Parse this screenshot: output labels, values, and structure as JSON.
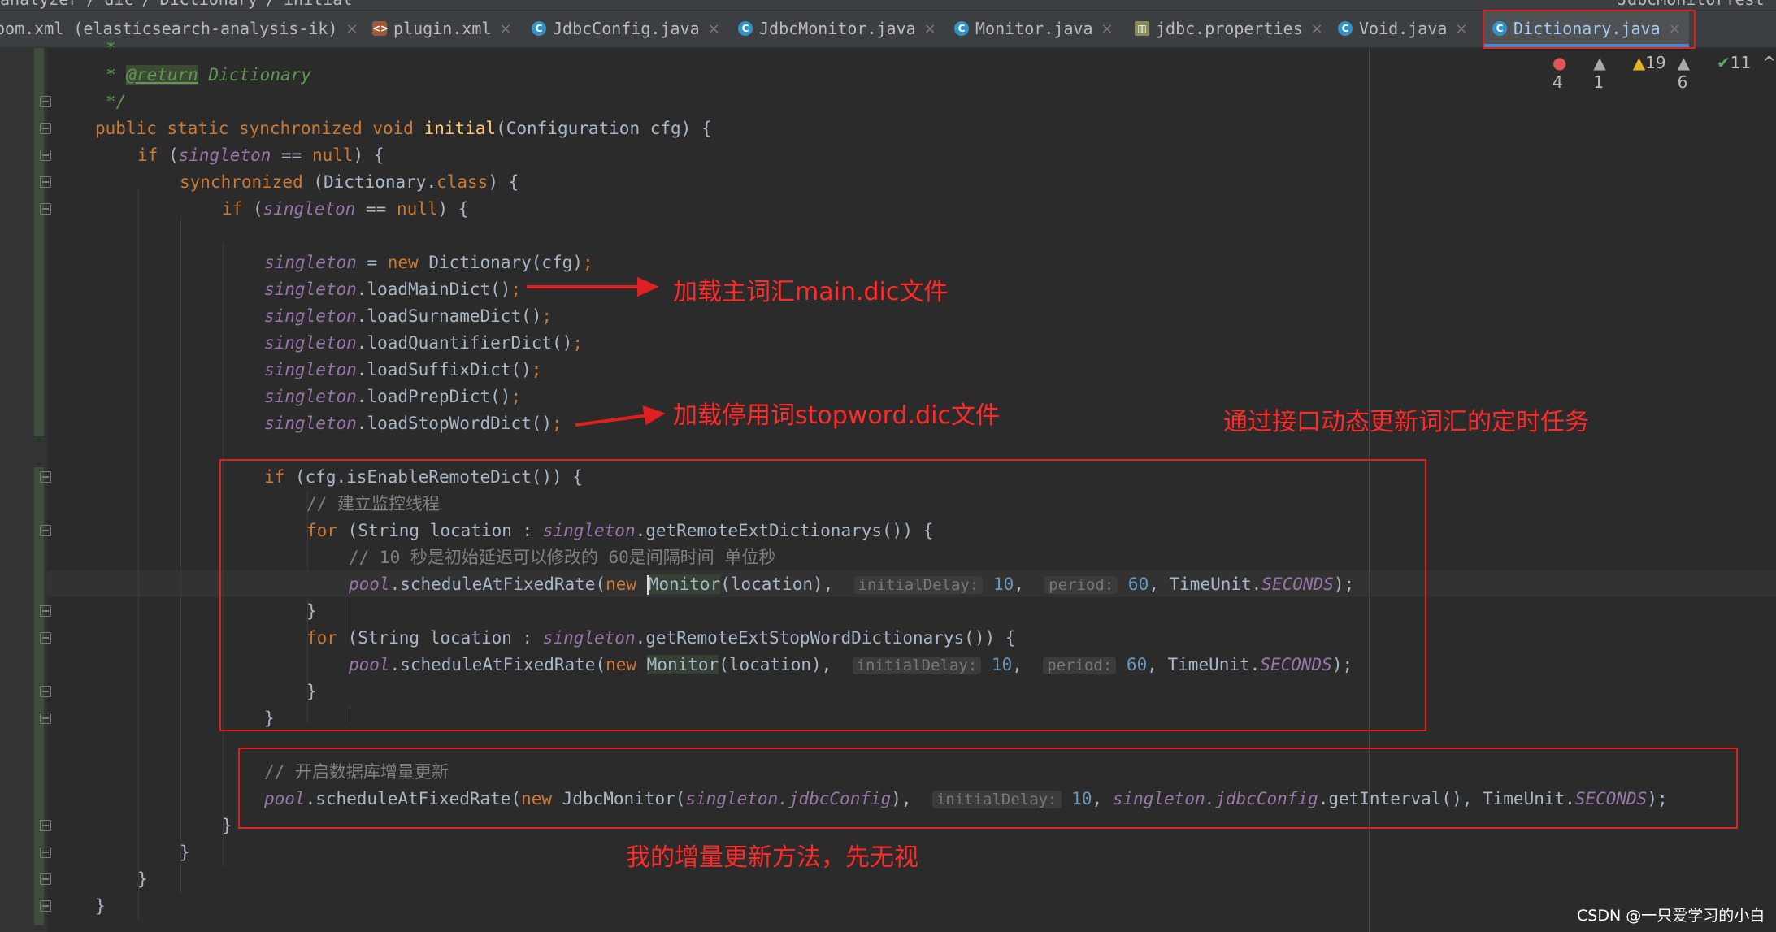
{
  "breadcrumb": {
    "items": [
      "analyzer",
      "dic",
      "Dictionary",
      "initial"
    ],
    "right_label": "JdbcMonitorTest"
  },
  "tabs": [
    {
      "label": "pom.xml (elasticsearch-analysis-ik)",
      "icon": "maven-icon"
    },
    {
      "label": "plugin.xml",
      "icon": "xml-file-icon"
    },
    {
      "label": "JdbcConfig.java",
      "icon": "java-class-icon"
    },
    {
      "label": "JdbcMonitor.java",
      "icon": "java-class-icon"
    },
    {
      "label": "Monitor.java",
      "icon": "java-class-icon"
    },
    {
      "label": "jdbc.properties",
      "icon": "properties-file-icon"
    },
    {
      "label": "Void.java",
      "icon": "java-class-icon"
    },
    {
      "label": "Dictionary.java",
      "icon": "java-class-icon",
      "active": true
    }
  ],
  "inspections": {
    "errors": "4",
    "warnings_gray": "1",
    "warnings": "19",
    "weak_warnings": "6",
    "typos": "11"
  },
  "code": {
    "l0": "*",
    "l1_tag": "@return",
    "l1_rest": " Dictionary",
    "l2": "*/",
    "l3_mods": "public static synchronized void ",
    "l3_name": "initial",
    "l3_rest": "(Configuration cfg) {",
    "l4_if": "if ",
    "l4_field": "singleton",
    "l4_eq": " == ",
    "l4_null": "null",
    "l4_end": ") {",
    "l5_sync": "synchronized ",
    "l5_mid": "(Dictionary.",
    "l5_class": "class",
    "l5_end": ") {",
    "l6_if": "if ",
    "l6_field": "singleton",
    "l6_eq": " == ",
    "l6_null": "null",
    "l6_end": ") {",
    "singleton": "singleton",
    "l8_assign": " = ",
    "l8_new": "new ",
    "l8_rest": "Dictionary(cfg)",
    "semi": ";",
    "call_main": ".loadMainDict()",
    "call_surname": ".loadSurnameDict()",
    "call_quant": ".loadQuantifierDict()",
    "call_suffix": ".loadSuffixDict()",
    "call_prep": ".loadPrepDict()",
    "call_stop": ".loadStopWordDict()",
    "l17_if": "if ",
    "l17_rest": "(cfg.isEnableRemoteDict()) {",
    "l18_comment": "// 建立监控线程",
    "for_kw": "for ",
    "for_head": "(String location : ",
    "for_ext": ".getRemoteExtDictionarys()) {",
    "for_stop": ".getRemoteExtStopWordDictionarys()) {",
    "l20_comment": "// 10 秒是初始延迟可以修改的 60是间隔时间 单位秒",
    "pool": "pool",
    "schedule": ".scheduleAtFixedRate(",
    "new_kw": "new ",
    "monitor": "Monitor",
    "monitor_cur_rest": "onitor",
    "monitor_first": "M",
    "loc_arg": "(location), ",
    "hint_delay": "initialDelay:",
    "ten": "10",
    "comma": ", ",
    "hint_period": "period:",
    "sixty": "60",
    "timeunit": "TimeUnit.",
    "seconds": "SECONDS",
    "close_call": ");",
    "brace": "}",
    "l27_comment": "// 开启数据库增量更新",
    "jdbc_new": "JdbcMonitor(",
    "jdbc_cfg": ".jdbcConfig",
    "jdbc_close": "), ",
    "get_interval": ".getInterval(), "
  },
  "annotations": {
    "main_dic": "加载主词汇main.dic文件",
    "stopword": "加载停用词stopword.dic文件",
    "remote_task": "通过接口动态更新词汇的定时任务",
    "incremental": "我的增量更新方法，先无视"
  },
  "watermark": "CSDN @一只爱学习的小白"
}
